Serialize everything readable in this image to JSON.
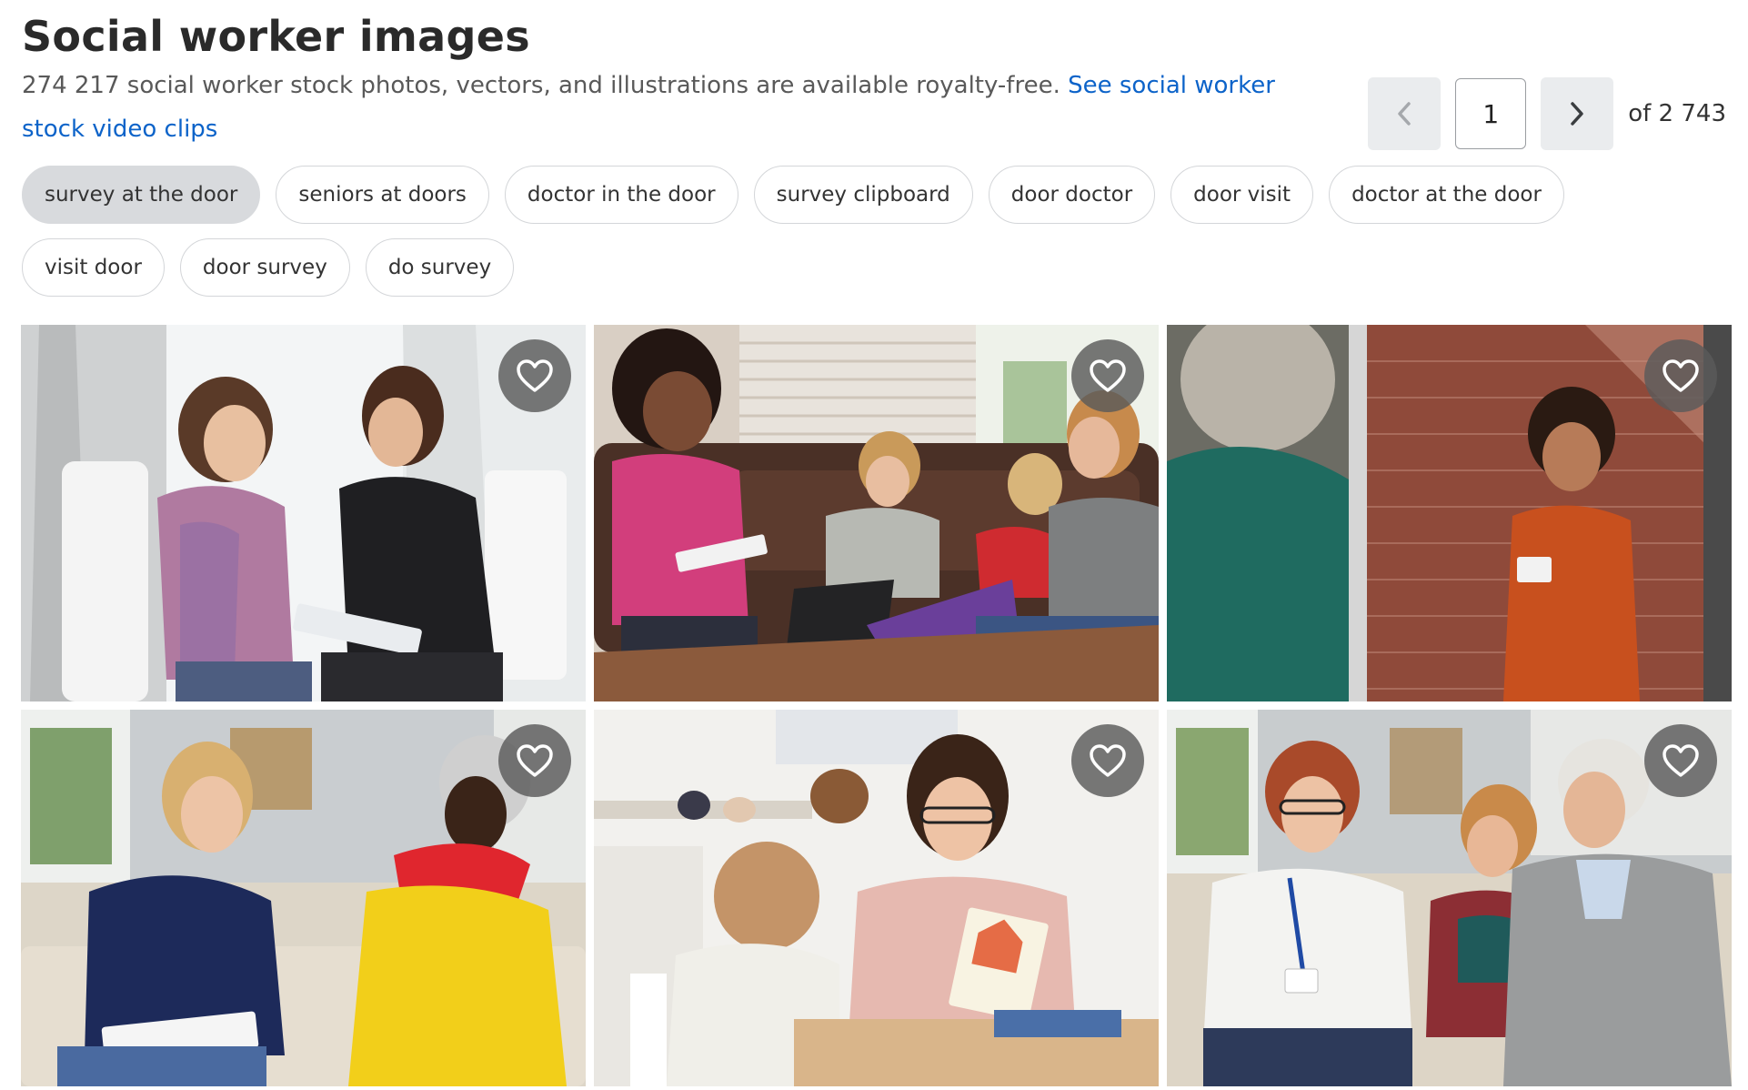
{
  "header": {
    "title": "Social worker images",
    "description": "274 217 social worker stock photos, vectors, and illustrations are available royalty-free.",
    "video_link": "See social worker stock video clips"
  },
  "pagination": {
    "prev_icon": "chevron-left-icon",
    "next_icon": "chevron-right-icon",
    "current_page": "1",
    "total_label": "of 2 743"
  },
  "related_searches": [
    {
      "label": "survey at the door",
      "active": true
    },
    {
      "label": "seniors at doors",
      "active": false
    },
    {
      "label": "doctor in the door",
      "active": false
    },
    {
      "label": "survey clipboard",
      "active": false
    },
    {
      "label": "door doctor",
      "active": false
    },
    {
      "label": "door visit",
      "active": false
    },
    {
      "label": "doctor at the door",
      "active": false
    },
    {
      "label": "visit door",
      "active": false
    },
    {
      "label": "door survey",
      "active": false
    },
    {
      "label": "do survey",
      "active": false
    }
  ],
  "results": {
    "favorite_icon": "heart-outline-icon",
    "images": [
      {
        "id": "image-1"
      },
      {
        "id": "image-2"
      },
      {
        "id": "image-3"
      },
      {
        "id": "image-4"
      },
      {
        "id": "image-5"
      },
      {
        "id": "image-6"
      }
    ]
  },
  "colors": {
    "link": "#0c63c9",
    "active_chip": "#d8dadd",
    "pager_button": "#eaecee"
  }
}
